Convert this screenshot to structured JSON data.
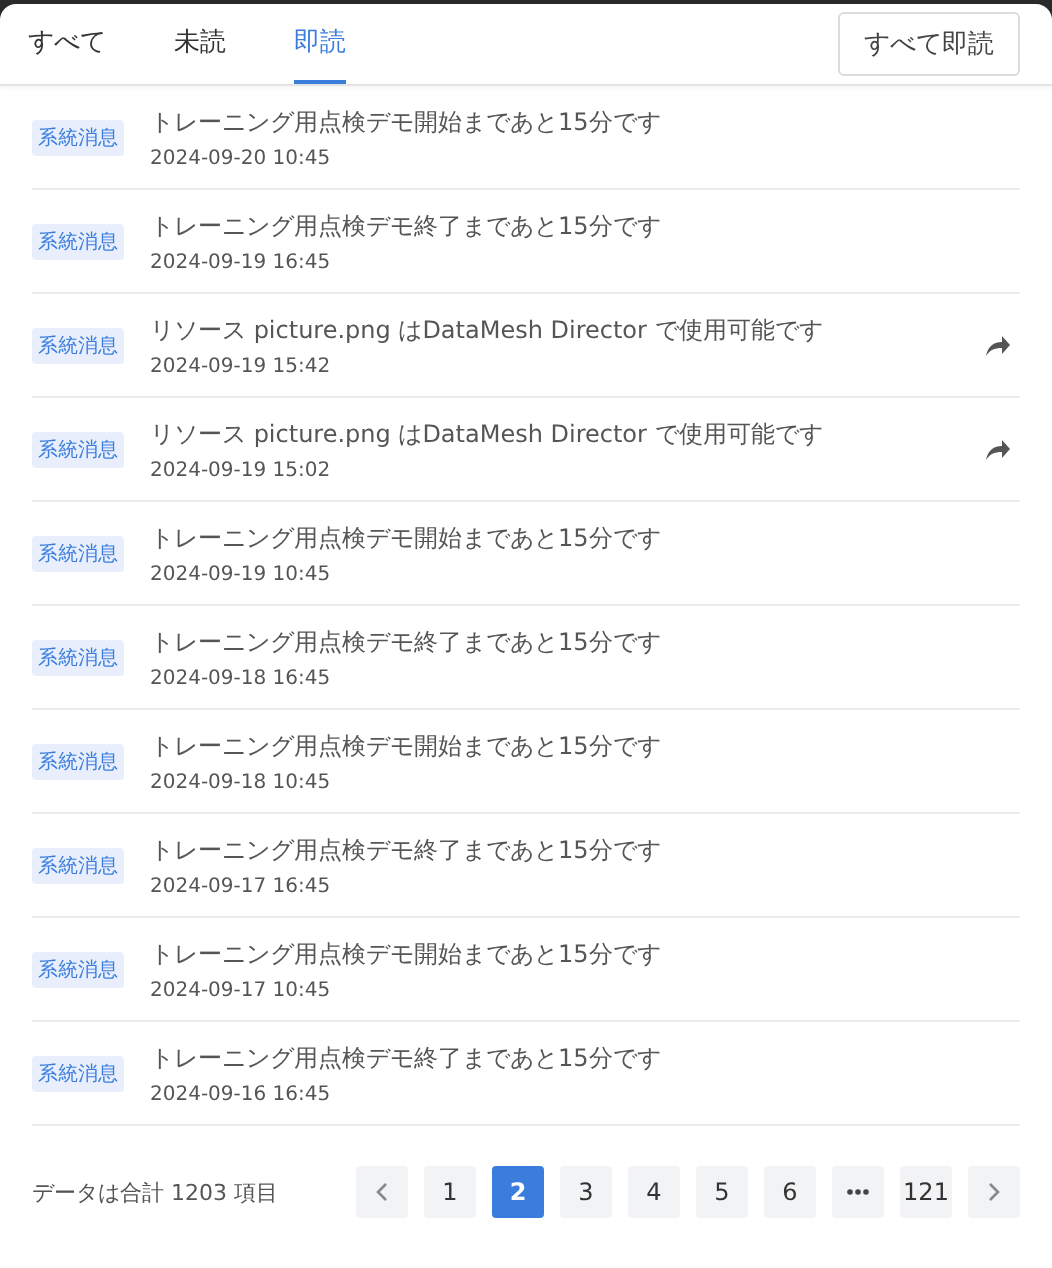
{
  "tabs": [
    {
      "label": "すべて",
      "selected": false
    },
    {
      "label": "未読",
      "selected": false
    },
    {
      "label": "即読",
      "selected": true
    }
  ],
  "mark_all_button": "すべて即読",
  "messages": [
    {
      "tag": "系統消息",
      "title": "トレーニング用点検デモ開始まであと15分です",
      "time": "2024-09-20 10:45",
      "share": false
    },
    {
      "tag": "系統消息",
      "title": "トレーニング用点検デモ終了まであと15分です",
      "time": "2024-09-19 16:45",
      "share": false
    },
    {
      "tag": "系統消息",
      "title": "リソース picture.png はDataMesh Director で使用可能です",
      "time": "2024-09-19 15:42",
      "share": true
    },
    {
      "tag": "系統消息",
      "title": "リソース picture.png はDataMesh Director で使用可能です",
      "time": "2024-09-19 15:02",
      "share": true
    },
    {
      "tag": "系統消息",
      "title": "トレーニング用点検デモ開始まであと15分です",
      "time": "2024-09-19 10:45",
      "share": false
    },
    {
      "tag": "系統消息",
      "title": "トレーニング用点検デモ終了まであと15分です",
      "time": "2024-09-18 16:45",
      "share": false
    },
    {
      "tag": "系統消息",
      "title": "トレーニング用点検デモ開始まであと15分です",
      "time": "2024-09-18 10:45",
      "share": false
    },
    {
      "tag": "系統消息",
      "title": "トレーニング用点検デモ終了まであと15分です",
      "time": "2024-09-17 16:45",
      "share": false
    },
    {
      "tag": "系統消息",
      "title": "トレーニング用点検デモ開始まであと15分です",
      "time": "2024-09-17 10:45",
      "share": false
    },
    {
      "tag": "系統消息",
      "title": "トレーニング用点検デモ終了まであと15分です",
      "time": "2024-09-16 16:45",
      "share": false
    }
  ],
  "pagination": {
    "total": "データは合計 1203 項目",
    "items": [
      {
        "kind": "prev"
      },
      {
        "kind": "page",
        "label": "1",
        "selected": false
      },
      {
        "kind": "page",
        "label": "2",
        "selected": true
      },
      {
        "kind": "page",
        "label": "3",
        "selected": false
      },
      {
        "kind": "page",
        "label": "4",
        "selected": false
      },
      {
        "kind": "page",
        "label": "5",
        "selected": false
      },
      {
        "kind": "page",
        "label": "6",
        "selected": false
      },
      {
        "kind": "more"
      },
      {
        "kind": "page",
        "label": "121",
        "selected": false
      },
      {
        "kind": "next"
      }
    ]
  }
}
